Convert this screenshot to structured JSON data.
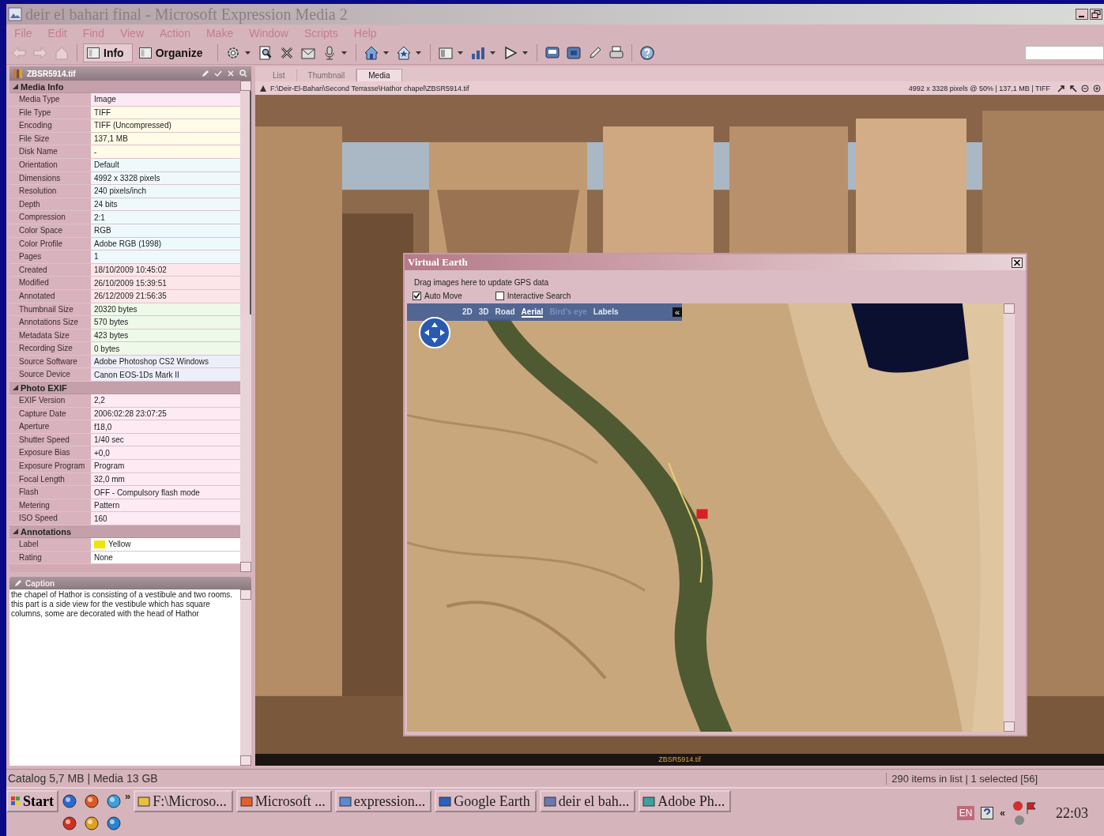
{
  "window": {
    "title": "deir el bahari final - Microsoft Expression Media 2"
  },
  "menu": [
    "File",
    "Edit",
    "Find",
    "View",
    "Action",
    "Make",
    "Window",
    "Scripts",
    "Help"
  ],
  "views": [
    {
      "label": "Info",
      "selected": true
    },
    {
      "label": "Organize",
      "selected": false
    }
  ],
  "info_panel": {
    "file_name": "ZBSR5914.tif",
    "sections": [
      {
        "title": "Media Info",
        "expanded": true,
        "rows": [
          {
            "label": "Media Type",
            "value": "Image",
            "color": "#fbe9f3"
          },
          {
            "label": "File Type",
            "value": "TIFF",
            "color": "#fffbe6"
          },
          {
            "label": "Encoding",
            "value": "TIFF (Uncompressed)",
            "color": "#fffbe6"
          },
          {
            "label": "File Size",
            "value": "137,1 MB",
            "color": "#fffbe6"
          },
          {
            "label": "Disk Name",
            "value": "-",
            "color": "#fffbe6"
          },
          {
            "label": "Orientation",
            "value": "Default",
            "color": "#eef9fc"
          },
          {
            "label": "Dimensions",
            "value": "4992 x 3328 pixels",
            "color": "#eef9fc"
          },
          {
            "label": "Resolution",
            "value": "240 pixels/inch",
            "color": "#eef9fc"
          },
          {
            "label": "Depth",
            "value": "24 bits",
            "color": "#eef9fc"
          },
          {
            "label": "Compression",
            "value": "2:1",
            "color": "#eef9fc"
          },
          {
            "label": "Color Space",
            "value": "RGB",
            "color": "#eef9fc"
          },
          {
            "label": "Color Profile",
            "value": "Adobe RGB (1998)",
            "color": "#eef9fc"
          },
          {
            "label": "Pages",
            "value": "1",
            "color": "#eef9fc"
          },
          {
            "label": "Created",
            "value": "18/10/2009 10:45:02",
            "color": "#fde6ea"
          },
          {
            "label": "Modified",
            "value": "26/10/2009 15:39:51",
            "color": "#fde6ea"
          },
          {
            "label": "Annotated",
            "value": "26/12/2009 21:56:35",
            "color": "#fde6ea"
          },
          {
            "label": "Thumbnail Size",
            "value": "20320 bytes",
            "color": "#eef9ea"
          },
          {
            "label": "Annotations Size",
            "value": "570 bytes",
            "color": "#eef9ea"
          },
          {
            "label": "Metadata Size",
            "value": "423 bytes",
            "color": "#eef9ea"
          },
          {
            "label": "Recording Size",
            "value": "0 bytes",
            "color": "#eef9ea"
          },
          {
            "label": "Source Software",
            "value": "Adobe Photoshop CS2 Windows",
            "color": "#eeeefa"
          },
          {
            "label": "Source Device",
            "value": "Canon EOS-1Ds Mark II",
            "color": "#eeeefa"
          }
        ]
      },
      {
        "title": "Photo EXIF",
        "expanded": true,
        "rows": [
          {
            "label": "EXIF Version",
            "value": "2,2",
            "color": "#fdeaf2"
          },
          {
            "label": "Capture Date",
            "value": "2006:02:28 23:07:25",
            "color": "#fdeaf2"
          },
          {
            "label": "Aperture",
            "value": "f18,0",
            "color": "#fdeaf2"
          },
          {
            "label": "Shutter Speed",
            "value": "1/40 sec",
            "color": "#fdeaf2"
          },
          {
            "label": "Exposure Bias",
            "value": "+0,0",
            "color": "#fdeaf2"
          },
          {
            "label": "Exposure Program",
            "value": "Program",
            "color": "#fdeaf2"
          },
          {
            "label": "Focal Length",
            "value": "32,0 mm",
            "color": "#fdeaf2"
          },
          {
            "label": "Flash",
            "value": "OFF - Compulsory flash mode",
            "color": "#fdeaf2"
          },
          {
            "label": "Metering",
            "value": "Pattern",
            "color": "#fdeaf2"
          },
          {
            "label": "ISO Speed",
            "value": "160",
            "color": "#fdeaf2"
          }
        ]
      },
      {
        "title": "Annotations",
        "expanded": true,
        "rows": [
          {
            "label": "Label",
            "value": "Yellow",
            "color": "#ffffff",
            "swatch": {
              "color": "#f0e400"
            }
          },
          {
            "label": "Rating",
            "value": "None",
            "color": "#ffffff"
          }
        ]
      }
    ]
  },
  "caption": {
    "title": "Caption",
    "text": "the chapel of Hathor is consisting of a vestibule and two rooms. this part is a side view for the vestibule which has square columns, some are decorated with the head of Hathor"
  },
  "tabs": [
    {
      "label": "List",
      "selected": false
    },
    {
      "label": "Thumbnail",
      "selected": false
    },
    {
      "label": "Media",
      "selected": true
    }
  ],
  "path_bar": {
    "path": "F:\\Deir-El-Bahari\\Second Terrasse\\Hathor chapel\\ZBSR5914.tif",
    "info": "4992 x 3328 pixels @ 50%  |  137,1 MB  |  TIFF"
  },
  "media_caption": "ZBSR5914.tif",
  "virtual_earth": {
    "title": "Virtual Earth",
    "hint": "Drag images here to update GPS data",
    "options": [
      {
        "label": "Auto Move",
        "checked": true
      },
      {
        "label": "Interactive Search",
        "checked": false
      }
    ],
    "map_modes": [
      {
        "label": "2D",
        "selected": false,
        "disabled": false
      },
      {
        "label": "3D",
        "selected": false,
        "disabled": false
      },
      {
        "label": "Road",
        "selected": false,
        "disabled": false
      },
      {
        "label": "Aerial",
        "selected": true,
        "disabled": false
      },
      {
        "label": "Bird's eye",
        "selected": false,
        "disabled": true
      },
      {
        "label": "Labels",
        "selected": false,
        "disabled": false
      }
    ],
    "collapse": "«"
  },
  "status_bar": {
    "left": "Catalog 5,7 MB  |  Media 13 GB",
    "right": "290 items in list  |  1 selected [56]"
  },
  "taskbar": {
    "start": "Start",
    "more": "»",
    "tasks": [
      "F:\\Microso...",
      "Microsoft ...",
      "expression...",
      "Google Earth",
      "deir el bah...",
      "Adobe Ph..."
    ],
    "language": "EN",
    "tray_more": "«",
    "time": "22:03"
  }
}
